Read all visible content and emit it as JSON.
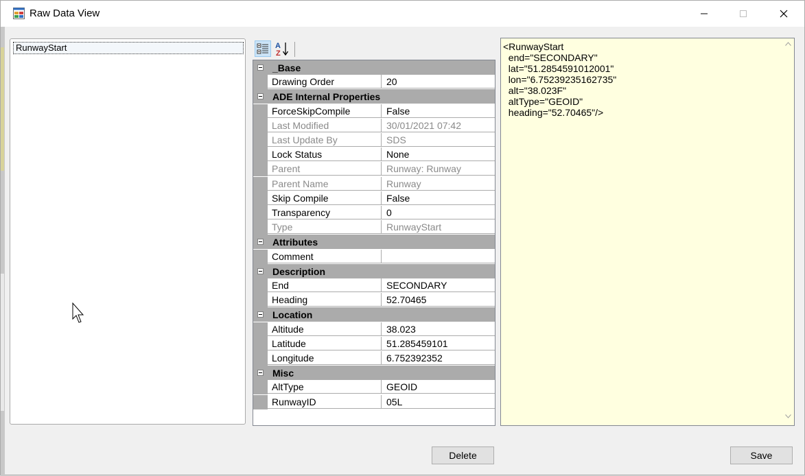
{
  "window": {
    "title": "Raw Data View",
    "controls": {
      "minimize": "minimize-icon",
      "maximize": "maximize-icon",
      "close": "close-icon"
    }
  },
  "list": {
    "items": [
      {
        "label": "RunwayStart",
        "selected": true
      }
    ]
  },
  "toolbar": {
    "categorized": "categorized-icon",
    "alphabetical": "sort-alpha-icon"
  },
  "grid": {
    "rows": [
      {
        "type": "category",
        "label": "_Base"
      },
      {
        "type": "property",
        "name": "Drawing Order",
        "value": "20",
        "readonly": false
      },
      {
        "type": "category",
        "label": "ADE Internal Properties"
      },
      {
        "type": "property",
        "name": "ForceSkipCompile",
        "value": "False",
        "readonly": false
      },
      {
        "type": "property",
        "name": "Last Modified",
        "value": "30/01/2021 07:42",
        "readonly": true
      },
      {
        "type": "property",
        "name": "Last Update By",
        "value": "SDS",
        "readonly": true
      },
      {
        "type": "property",
        "name": "Lock Status",
        "value": "None",
        "readonly": false
      },
      {
        "type": "property",
        "name": "Parent",
        "value": "Runway: Runway",
        "readonly": true
      },
      {
        "type": "property",
        "name": "Parent Name",
        "value": "Runway",
        "readonly": true
      },
      {
        "type": "property",
        "name": "Skip Compile",
        "value": "False",
        "readonly": false
      },
      {
        "type": "property",
        "name": "Transparency",
        "value": "0",
        "readonly": false
      },
      {
        "type": "property",
        "name": "Type",
        "value": "RunwayStart",
        "readonly": true
      },
      {
        "type": "category",
        "label": "Attributes"
      },
      {
        "type": "property",
        "name": "Comment",
        "value": "",
        "readonly": false
      },
      {
        "type": "category",
        "label": "Description"
      },
      {
        "type": "property",
        "name": "End",
        "value": "SECONDARY",
        "readonly": false
      },
      {
        "type": "property",
        "name": "Heading",
        "value": "52.70465",
        "readonly": false
      },
      {
        "type": "category",
        "label": "Location"
      },
      {
        "type": "property",
        "name": "Altitude",
        "value": "38.023",
        "readonly": false
      },
      {
        "type": "property",
        "name": "Latitude",
        "value": "51.285459101",
        "readonly": false
      },
      {
        "type": "property",
        "name": "Longitude",
        "value": "6.752392352",
        "readonly": false
      },
      {
        "type": "category",
        "label": "Misc"
      },
      {
        "type": "property",
        "name": "AltType",
        "value": "GEOID",
        "readonly": false
      },
      {
        "type": "property",
        "name": "RunwayID",
        "value": "05L",
        "readonly": false
      }
    ]
  },
  "xml": {
    "text": "<RunwayStart\n  end=\"SECONDARY\"\n  lat=\"51.2854591012001\"\n  lon=\"6.75239235162735\"\n  alt=\"38.023F\"\n  altType=\"GEOID\"\n  heading=\"52.70465\"/>"
  },
  "buttons": {
    "delete": "Delete",
    "save": "Save"
  }
}
